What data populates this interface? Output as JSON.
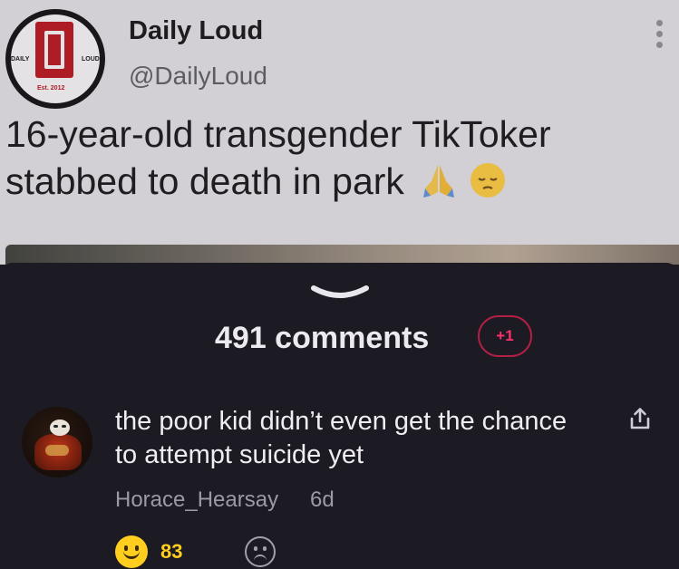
{
  "tweet": {
    "logo": {
      "left_text": "DAILY",
      "right_text": "LOUD",
      "est_text": "Est. 2012"
    },
    "name": "Daily Loud",
    "handle": "@DailyLoud",
    "text": "16-year-old transgender TikToker stabbed to death in park",
    "emojis": [
      "folded-hands-emoji",
      "pensive-face-emoji"
    ]
  },
  "comments_sheet": {
    "count_label": "491 comments",
    "new_badge": "+1"
  },
  "comment": {
    "text": "the poor kid didn’t even get the chance to attempt suicide yet",
    "username": "Horace_Hearsay",
    "time": "6d",
    "reactions": {
      "happy_count": "83"
    }
  },
  "colors": {
    "sheet_bg": "#1c1a23",
    "badge_accent": "#ff2f6b",
    "reaction_yellow": "#ffce1f"
  }
}
